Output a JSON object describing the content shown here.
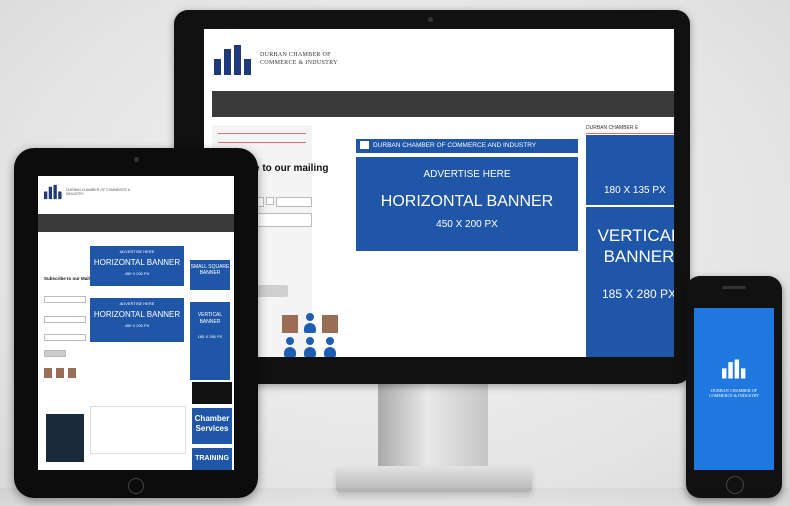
{
  "org_name": "DURBAN CHAMBER OF COMMERCE & INDUSTRY",
  "org_name_line1": "DURBAN CHAMBER OF",
  "org_name_line2": "COMMERCE & INDUSTRY",
  "desktop": {
    "mailing_text": "e to our mailing",
    "top_bar_text": "DURBAN CHAMBER OF COMMERCE AND INDUSTRY",
    "horizontal_banner": {
      "line1": "ADVERTISE HERE",
      "line2": "HORIZONTAL BANNER",
      "line3": "450 X 200 PX"
    },
    "right_title": "DURBAN CHAMBER E",
    "square_banner": "180 X 135 PX",
    "vertical_banner": {
      "line1": "VERTICAL",
      "line2": "BANNER",
      "line3": "185 X 280 PX"
    }
  },
  "tablet": {
    "mailing_text": "Subscribe to our Mailing list",
    "banner1": {
      "line1": "ADVERTISE HERE",
      "line2": "HORIZONTAL BANNER",
      "line3": "450 X 200 PX"
    },
    "banner2": {
      "line1": "ADVERTISE HERE",
      "line2": "HORIZONTAL BANNER",
      "line3": "450 X 200 PX"
    },
    "small_square": "SMALL SQUARE BANNER",
    "vertical": {
      "line1": "VERTICAL",
      "line2": "BANNER",
      "line3": "185 X 280 PX"
    },
    "chamber_services": {
      "line1": "Chamber",
      "line2": "Services"
    },
    "training": "TRAINING"
  },
  "colors": {
    "banner_blue": "#1f56a8",
    "nav_dark": "#3a3a3a",
    "phone_blue": "#1f78e0"
  }
}
